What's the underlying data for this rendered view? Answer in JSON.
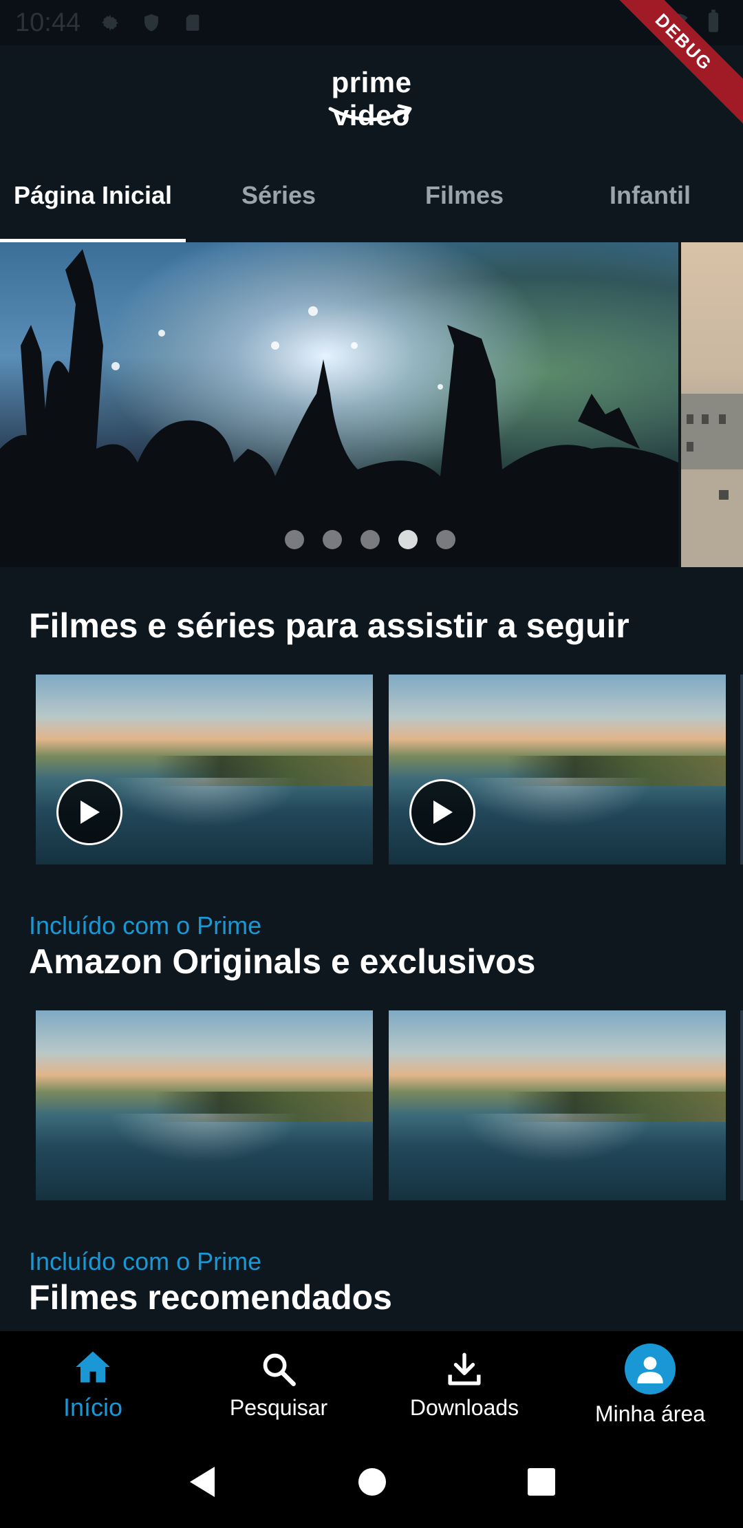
{
  "status_bar": {
    "time": "10:44"
  },
  "debug": {
    "label": "DEBUG"
  },
  "header": {
    "logo_text": "prime video"
  },
  "tabs": [
    {
      "label": "Página Inicial",
      "active": true
    },
    {
      "label": "Séries",
      "active": false
    },
    {
      "label": "Filmes",
      "active": false
    },
    {
      "label": "Infantil",
      "active": false
    }
  ],
  "carousel": {
    "dot_count": 5,
    "active_index": 3
  },
  "sections": [
    {
      "subtitle": "",
      "title": "Filmes e séries para assistir a seguir"
    },
    {
      "subtitle": "Incluído com o Prime",
      "title": "Amazon Originals e exclusivos"
    },
    {
      "subtitle": "Incluído com o Prime",
      "title": "Filmes recomendados"
    }
  ],
  "bottom_nav": [
    {
      "label": "Início",
      "icon": "home-icon",
      "active": true
    },
    {
      "label": "Pesquisar",
      "icon": "search-icon",
      "active": false
    },
    {
      "label": "Downloads",
      "icon": "download-icon",
      "active": false
    },
    {
      "label": "Minha área",
      "icon": "profile-avatar-icon",
      "active": false
    }
  ],
  "colors": {
    "background": "#0f171e",
    "accent": "#1a98d5",
    "nav_background": "#000000",
    "debug_ribbon": "#a01b26"
  }
}
